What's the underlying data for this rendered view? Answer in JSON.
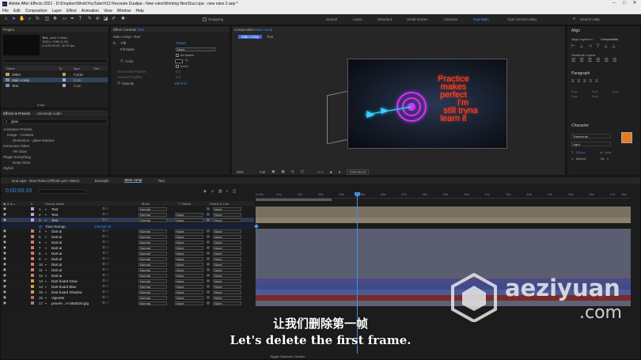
{
  "window": {
    "title": "Adobe After Effects 2021 - D:\\Dropbox\\Work\\YouTube\\#12 Recreate Dualipa - New rules\\Working files\\Dua Lipa - new rules 2.aep *"
  },
  "menu": [
    "File",
    "Edit",
    "Composition",
    "Layer",
    "Effect",
    "Animation",
    "View",
    "Window",
    "Help"
  ],
  "toolbar": {
    "snapping": "Snapping",
    "workspaces": [
      "Default",
      "Learn",
      "Standard",
      "Small Screen",
      "Libraries",
      "Gyto Bain",
      "Gyto Vertical video"
    ],
    "active_workspace": "Gyto Bain",
    "search_placeholder": "Search Help"
  },
  "project": {
    "tab": "Project",
    "selected_name": "Text",
    "selected_usage": ", used 3 times",
    "selected_info": [
      "1920 x 1080 (1.00)",
      "Δ 0;00;05;25, 30.00 fps"
    ],
    "columns": [
      "Name",
      "Ty",
      "Type",
      "Size"
    ],
    "items": [
      {
        "name": "Other",
        "type": "Folder"
      },
      {
        "name": "Main comp",
        "type": "Com"
      },
      {
        "name": "Text",
        "type": "Com"
      }
    ],
    "bpc": "8 bpc"
  },
  "effects_presets": {
    "tabs": [
      "Effects & Presets",
      "Universal Audio"
    ],
    "search_value": "glow",
    "tree": [
      "Animation Presets",
      "Image - Creative",
      "Dimension - glow+shadow",
      "Immersive Video",
      "VR Glow",
      "Plugin Everything",
      "Deep Glow",
      "Stylize"
    ]
  },
  "effect_controls": {
    "tab": "Effect Controls",
    "layer": "Text",
    "header": "Main comp • Text",
    "effect_name": "Fill",
    "reset": "Reset",
    "properties": [
      {
        "label": "Fill Mask",
        "value": "None"
      },
      {
        "label": "",
        "value": "All Masks"
      },
      {
        "label": "Color",
        "value": ""
      },
      {
        "label": "",
        "value": "Invert"
      },
      {
        "label": "Horizontal Feather",
        "value": "0.0"
      },
      {
        "label": "Vertical Feather",
        "value": "0.0"
      },
      {
        "label": "Opacity",
        "value": "100.0 %"
      }
    ]
  },
  "composition": {
    "tab": "Composition",
    "comp_name": "Main comp",
    "subtabs": [
      "Main comp",
      "Text"
    ],
    "neon_text": [
      "Practice",
      "makes",
      "perfect",
      "I'm",
      "still tryna",
      "learn it"
    ],
    "zoom": "50%",
    "quality": "Full",
    "exposure": "+0.0",
    "timecode": "0;00;05;10"
  },
  "align": {
    "title": "Align",
    "align_to_label": "Align Layers to:",
    "align_to_value": "Composition",
    "distribute": "Distribute Layers:"
  },
  "paragraph": {
    "title": "Paragraph",
    "values": [
      "0 px",
      "0 px",
      "0 px",
      "0 px",
      "0 px"
    ]
  },
  "character": {
    "title": "Character",
    "font": "Trancmute",
    "style": "Light",
    "size": "124 px",
    "leading": "Auto",
    "tracking": "0",
    "kerning": "Metrics",
    "fill_color": "#e77b1c"
  },
  "timeline": {
    "tabs": [
      "Dua Lipa - New Rules (Official Lyric Video)",
      "Example",
      "Main comp",
      "Text"
    ],
    "active_tab": "Main comp",
    "timecode": "0:00:05:10",
    "columns": [
      "#",
      "Source Name",
      "Mode",
      "T TrkMat",
      "Parent & Link"
    ],
    "time_remap": {
      "label": "Time Remap",
      "value": "0:00:05:10"
    },
    "ruler": [
      "0:00s",
      "01s",
      "02s",
      "03s",
      "04s",
      "05s",
      "06s",
      "07s",
      "08s",
      "09s",
      "10s",
      "11s",
      "12s",
      "13s",
      "14s",
      "15s",
      "16s",
      "17s",
      "18s"
    ],
    "layers": [
      {
        "num": "1",
        "name": "Text",
        "mode": "Normal",
        "trkmat": "",
        "parent": "None"
      },
      {
        "num": "2",
        "name": "Text",
        "mode": "Normal",
        "trkmat": "None",
        "parent": "None"
      },
      {
        "num": "3",
        "name": "Text",
        "mode": "Normal",
        "trkmat": "None",
        "parent": "None"
      },
      {
        "num": "4",
        "name": "Dart.ai",
        "mode": "Normal",
        "trkmat": "None",
        "parent": "None"
      },
      {
        "num": "5",
        "name": "Dart.ai",
        "mode": "Normal",
        "trkmat": "None",
        "parent": "None"
      },
      {
        "num": "6",
        "name": "Dart.ai",
        "mode": "Normal",
        "trkmat": "None",
        "parent": "None"
      },
      {
        "num": "7",
        "name": "Dart.ai",
        "mode": "Normal",
        "trkmat": "None",
        "parent": "None"
      },
      {
        "num": "8",
        "name": "Dart.ai",
        "mode": "Normal",
        "trkmat": "None",
        "parent": "None"
      },
      {
        "num": "9",
        "name": "Dart.ai",
        "mode": "Normal",
        "trkmat": "None",
        "parent": "None"
      },
      {
        "num": "10",
        "name": "Dart.ai",
        "mode": "Normal",
        "trkmat": "None",
        "parent": "None"
      },
      {
        "num": "11",
        "name": "Dart.ai",
        "mode": "Normal",
        "trkmat": "None",
        "parent": "None"
      },
      {
        "num": "12",
        "name": "Dart.ai",
        "mode": "Normal",
        "trkmat": "None",
        "parent": "None"
      },
      {
        "num": "13",
        "name": "Dart board Glow",
        "mode": "Normal",
        "trkmat": "None",
        "parent": "None"
      },
      {
        "num": "14",
        "name": "Dart board Blue",
        "mode": "Normal",
        "trkmat": "None",
        "parent": "None"
      },
      {
        "num": "15",
        "name": "Dart board Shadow",
        "mode": "Normal",
        "trkmat": "None",
        "parent": "None"
      },
      {
        "num": "16",
        "name": "Vignette",
        "mode": "Normal",
        "trkmat": "None",
        "parent": "None"
      },
      {
        "num": "17",
        "name": "pexels-...e-1654020.jpg",
        "mode": "Normal",
        "trkmat": "None",
        "parent": "None"
      }
    ],
    "footer": "Toggle Switches / Modes"
  },
  "watermark": {
    "site": "aeziyuan",
    "tld": ".com"
  },
  "subtitles": {
    "cn": "让我们删除第一帧",
    "en": "Let's delete the first frame."
  }
}
